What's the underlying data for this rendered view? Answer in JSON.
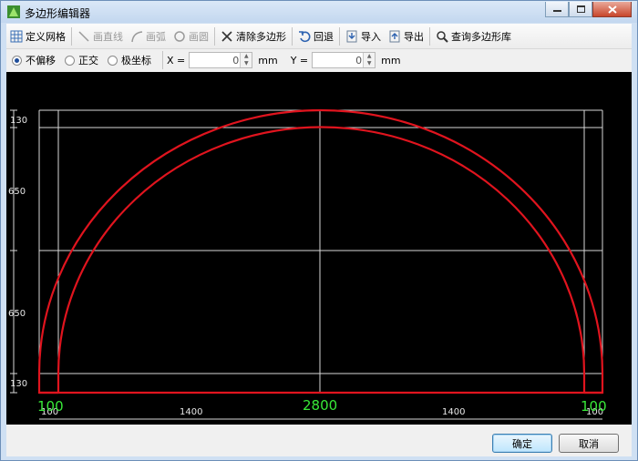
{
  "window": {
    "title": "多边形编辑器"
  },
  "toolbar": {
    "define_grid": "定义网格",
    "draw_line": "画直线",
    "draw_arc": "画弧",
    "draw_circle": "画圆",
    "clear_polygon": "清除多边形",
    "undo": "回退",
    "import": "导入",
    "export": "导出",
    "query_library": "查询多边形库"
  },
  "snap": {
    "options": [
      "不偏移",
      "正交",
      "极坐标"
    ],
    "selected": "不偏移",
    "x_label": "X =",
    "x_value": "0",
    "x_unit": "mm",
    "y_label": "Y =",
    "y_value": "0",
    "y_unit": "mm"
  },
  "canvas": {
    "left_dims": [
      "130",
      "650",
      "650",
      "130"
    ],
    "bottom_small": [
      "100",
      "1400",
      "1400",
      "100"
    ],
    "bottom_big": [
      "100",
      "2800",
      "100"
    ],
    "colors": {
      "background": "#000000",
      "grid": "#d8d8d8",
      "shape": "#e0141e",
      "dim_text": "#38e838"
    }
  },
  "footer": {
    "ok": "确定",
    "cancel": "取消"
  }
}
